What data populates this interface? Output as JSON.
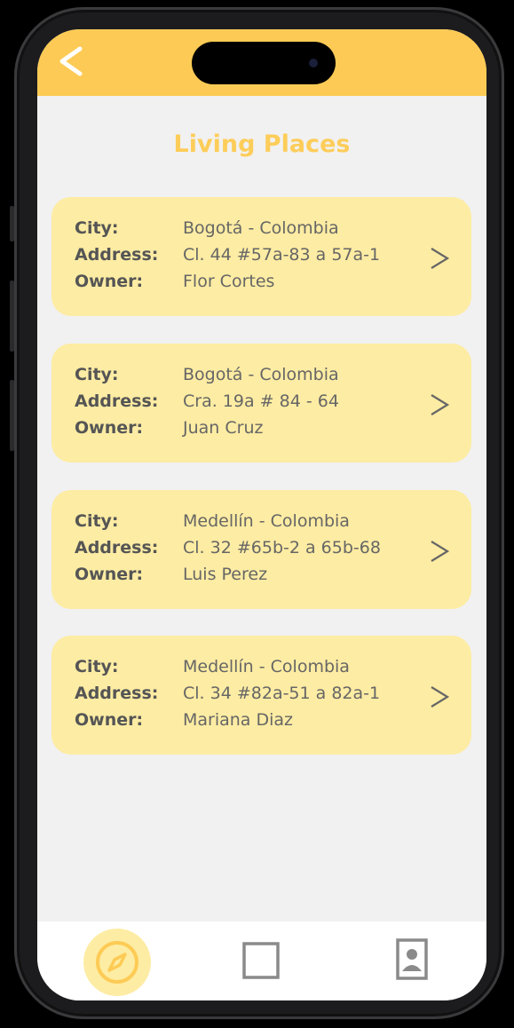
{
  "colors": {
    "header": "#fdcb55",
    "title": "#fdcd5a",
    "card": "#fdeca3",
    "background": "#f1f1f1",
    "label": "#555555",
    "value": "#666666"
  },
  "header": {
    "back_icon": "chevron-left-icon"
  },
  "page": {
    "title": "Living Places"
  },
  "places": [
    {
      "city_label": "City:",
      "city": "Bogotá - Colombia",
      "address_label": "Address:",
      "address": "Cl. 44 #57a-83 a 57a-1",
      "owner_label": "Owner:",
      "owner": "Flor Cortes"
    },
    {
      "city_label": "City:",
      "city": "Bogotá - Colombia",
      "address_label": "Address:",
      "address": "Cra. 19a # 84 - 64",
      "owner_label": "Owner:",
      "owner": "Juan Cruz"
    },
    {
      "city_label": "City:",
      "city": "Medellín - Colombia",
      "address_label": "Address:",
      "address": "Cl. 32 #65b-2 a 65b-68",
      "owner_label": "Owner:",
      "owner": "Luis Perez"
    },
    {
      "city_label": "City:",
      "city": "Medellín - Colombia",
      "address_label": "Address:",
      "address": "Cl. 34 #82a-51 a 82a-1",
      "owner_label": "Owner:",
      "owner": "Mariana Diaz"
    }
  ],
  "bottom_nav": {
    "items": [
      {
        "icon": "compass-icon",
        "active": true
      },
      {
        "icon": "square-icon",
        "active": false
      },
      {
        "icon": "contact-card-icon",
        "active": false
      }
    ]
  }
}
